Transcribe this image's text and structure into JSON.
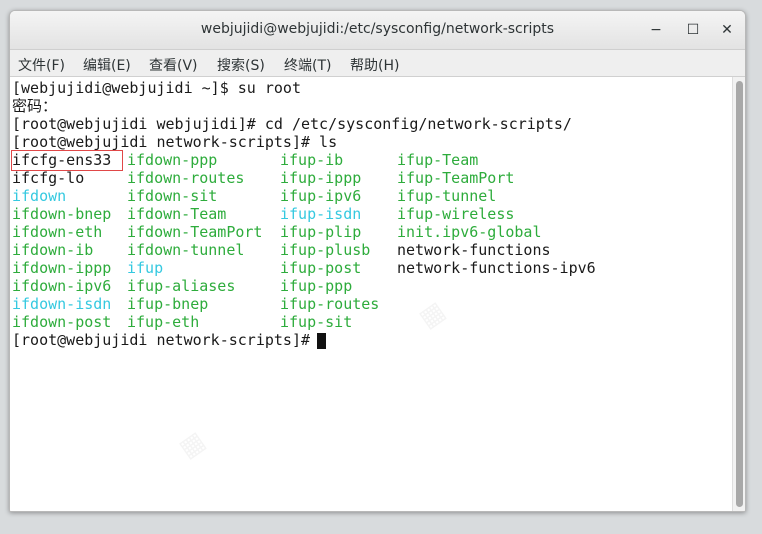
{
  "window": {
    "title": "webjujidi@webjujidi:/etc/sysconfig/network-scripts",
    "minimize_glyph": "−",
    "maximize_glyph": "☐",
    "close_glyph": "✕"
  },
  "menu": [
    "文件(F)",
    "编辑(E)",
    "查看(V)",
    "搜索(S)",
    "终端(T)",
    "帮助(H)"
  ],
  "colors": {
    "green": "#2eac3c",
    "cyan": "#35c9e0",
    "default": "#1a1a1a",
    "highlight_border": "#e04848"
  },
  "terminal": {
    "lines": [
      "[webjujidi@webjujidi ~]$ su root",
      "密码：",
      "[root@webjujidi webjujidi]# cd /etc/sysconfig/network-scripts/",
      "[root@webjujidi network-scripts]# ls"
    ],
    "ls_rows": [
      [
        {
          "t": "ifcfg-ens33",
          "c": "default"
        },
        {
          "t": "ifdown-ppp",
          "c": "green"
        },
        {
          "t": "ifup-ib",
          "c": "green"
        },
        {
          "t": "ifup-Team",
          "c": "green"
        }
      ],
      [
        {
          "t": "ifcfg-lo",
          "c": "default"
        },
        {
          "t": "ifdown-routes",
          "c": "green"
        },
        {
          "t": "ifup-ippp",
          "c": "green"
        },
        {
          "t": "ifup-TeamPort",
          "c": "green"
        }
      ],
      [
        {
          "t": "ifdown",
          "c": "cyan"
        },
        {
          "t": "ifdown-sit",
          "c": "green"
        },
        {
          "t": "ifup-ipv6",
          "c": "green"
        },
        {
          "t": "ifup-tunnel",
          "c": "green"
        }
      ],
      [
        {
          "t": "ifdown-bnep",
          "c": "green"
        },
        {
          "t": "ifdown-Team",
          "c": "green"
        },
        {
          "t": "ifup-isdn",
          "c": "cyan"
        },
        {
          "t": "ifup-wireless",
          "c": "green"
        }
      ],
      [
        {
          "t": "ifdown-eth",
          "c": "green"
        },
        {
          "t": "ifdown-TeamPort",
          "c": "green"
        },
        {
          "t": "ifup-plip",
          "c": "green"
        },
        {
          "t": "init.ipv6-global",
          "c": "green"
        }
      ],
      [
        {
          "t": "ifdown-ib",
          "c": "green"
        },
        {
          "t": "ifdown-tunnel",
          "c": "green"
        },
        {
          "t": "ifup-plusb",
          "c": "green"
        },
        {
          "t": "network-functions",
          "c": "default"
        }
      ],
      [
        {
          "t": "ifdown-ippp",
          "c": "green"
        },
        {
          "t": "ifup",
          "c": "cyan"
        },
        {
          "t": "ifup-post",
          "c": "green"
        },
        {
          "t": "network-functions-ipv6",
          "c": "default"
        }
      ],
      [
        {
          "t": "ifdown-ipv6",
          "c": "green"
        },
        {
          "t": "ifup-aliases",
          "c": "green"
        },
        {
          "t": "ifup-ppp",
          "c": "green"
        },
        {
          "t": "",
          "c": "default"
        }
      ],
      [
        {
          "t": "ifdown-isdn",
          "c": "cyan"
        },
        {
          "t": "ifup-bnep",
          "c": "green"
        },
        {
          "t": "ifup-routes",
          "c": "green"
        },
        {
          "t": "",
          "c": "default"
        }
      ],
      [
        {
          "t": "ifdown-post",
          "c": "green"
        },
        {
          "t": "ifup-eth",
          "c": "green"
        },
        {
          "t": "ifup-sit",
          "c": "green"
        },
        {
          "t": "",
          "c": "default"
        }
      ]
    ],
    "prompt": "[root@webjujidi network-scripts]# "
  }
}
